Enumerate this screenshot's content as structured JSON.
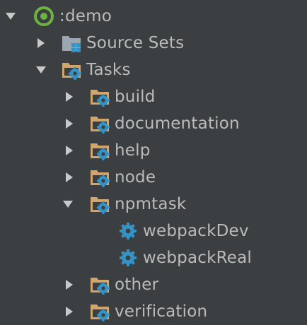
{
  "tree": {
    "root": {
      "label": ":demo",
      "expanded": true,
      "icon": "gradle-module-icon"
    },
    "source_sets": {
      "label": "Source Sets",
      "expanded": false,
      "icon": "source-sets-folder-icon"
    },
    "tasks": {
      "label": "Tasks",
      "expanded": true,
      "icon": "task-folder-icon",
      "groups": {
        "build": {
          "label": "build",
          "expanded": false
        },
        "documentation": {
          "label": "documentation",
          "expanded": false
        },
        "help": {
          "label": "help",
          "expanded": false
        },
        "node": {
          "label": "node",
          "expanded": false
        },
        "npmtask": {
          "label": "npmtask",
          "expanded": true,
          "tasks": {
            "webpack_dev": {
              "label": "webpackDev",
              "icon": "gear-icon"
            },
            "webpack_real": {
              "label": "webpackReal",
              "icon": "gear-icon"
            }
          }
        },
        "other": {
          "label": "other",
          "expanded": false
        },
        "verification": {
          "label": "verification",
          "expanded": false
        }
      }
    }
  },
  "colors": {
    "background": "#3c3f41",
    "text": "#bbbbbb",
    "arrow": "#c8c8c8",
    "folder": "#d2a56b",
    "gear": "#3592c4",
    "module_ring": "#6cb33f"
  }
}
